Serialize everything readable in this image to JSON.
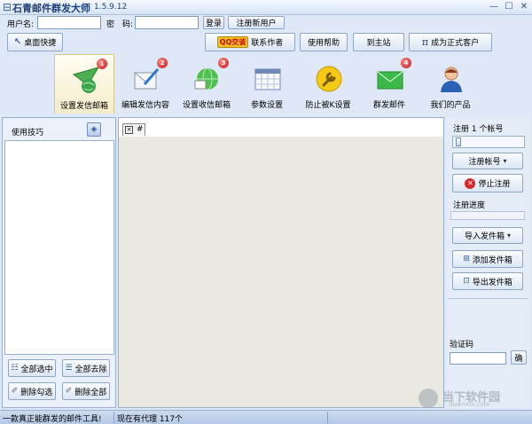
{
  "window": {
    "title": "石青邮件群发大师",
    "version": "1.5.9.12",
    "controls": [
      "minimize-icon",
      "maximize-icon",
      "close-icon"
    ]
  },
  "login": {
    "username_label": "用户名:",
    "username_value": "",
    "password_label": "密　码:",
    "password_value": "",
    "login_button": "登录",
    "register_button": "注册新用户"
  },
  "toolbar": {
    "desktop_shortcut": "桌面快捷",
    "qq_badge": "QQ交谈",
    "contact_author": "联系作者",
    "help": "使用帮助",
    "home": "到主站",
    "pi_symbol": "π",
    "upgrade": "成为正式客户"
  },
  "tools": [
    {
      "label": "设置发信邮箱",
      "badge": "1",
      "icon": "paper-plane-globe-icon",
      "active": true
    },
    {
      "label": "编辑发信内容",
      "badge": "2",
      "icon": "envelope-pencil-icon",
      "active": false
    },
    {
      "label": "设置收信邮箱",
      "badge": "3",
      "icon": "globe-mail-icon",
      "active": false
    },
    {
      "label": "参数设置",
      "badge": "",
      "icon": "calendar-grid-icon",
      "active": false
    },
    {
      "label": "防止被K设置",
      "badge": "",
      "icon": "wrench-icon",
      "active": false
    },
    {
      "label": "群发邮件",
      "badge": "4",
      "icon": "green-envelope-icon",
      "active": false
    },
    {
      "label": "我们的产品",
      "badge": "",
      "icon": "user-avatar-icon",
      "active": false
    }
  ],
  "left": {
    "tips_title": "使用技巧",
    "tips_items": [],
    "select_all": "全部选中",
    "deselect_all": "全部去除",
    "delete_checked": "删除勾选",
    "delete_all": "删除全部"
  },
  "center": {
    "tab_close": "×",
    "tab_label": "#"
  },
  "right": {
    "register_count_label": "注册 1 个帐号",
    "slider_level": 0.02,
    "register_accounts": "注册帐号",
    "stop_register": "停止注册",
    "progress_label": "注册进度",
    "progress": 0,
    "import_senders": "导入发件箱",
    "add_sender": "添加发件箱",
    "export_senders": "导出发件箱",
    "captcha_label": "验证码",
    "captcha_value": "",
    "confirm": "确"
  },
  "status": {
    "slogan": "一款真正能群发的邮件工具!",
    "proxy": "现在有代理 117个"
  },
  "watermark": {
    "text": "当下软件园",
    "url": "downxia.com"
  }
}
